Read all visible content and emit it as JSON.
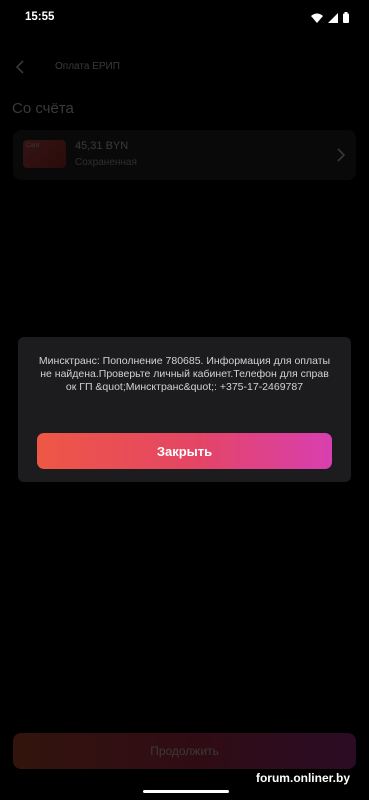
{
  "status_bar": {
    "time": "15:55",
    "icons": [
      "wifi-icon",
      "signal-icon",
      "battery-icon"
    ]
  },
  "background": {
    "header_title": "Оплата ЕРИП",
    "section_title": "Со счёта",
    "account": {
      "card_thumb_text": "Card",
      "amount": "45,31 BYN",
      "subtitle": "Сохраненная"
    },
    "continue_label": "Продолжить"
  },
  "dialog": {
    "message": "Минсктранс: Пополнение 780685. Информация для оплаты не найдена.Проверьте личный кабинет.Телефон для справок ГП &quot;Минсктранс&quot;: +375-17-2469787",
    "close_label": "Закрыть"
  },
  "watermark": "forum.onliner.by",
  "colors": {
    "accent_start": "#ee5745",
    "accent_mid": "#e44566",
    "accent_end": "#d83fb0",
    "dialog_bg": "#1c1c1e"
  }
}
